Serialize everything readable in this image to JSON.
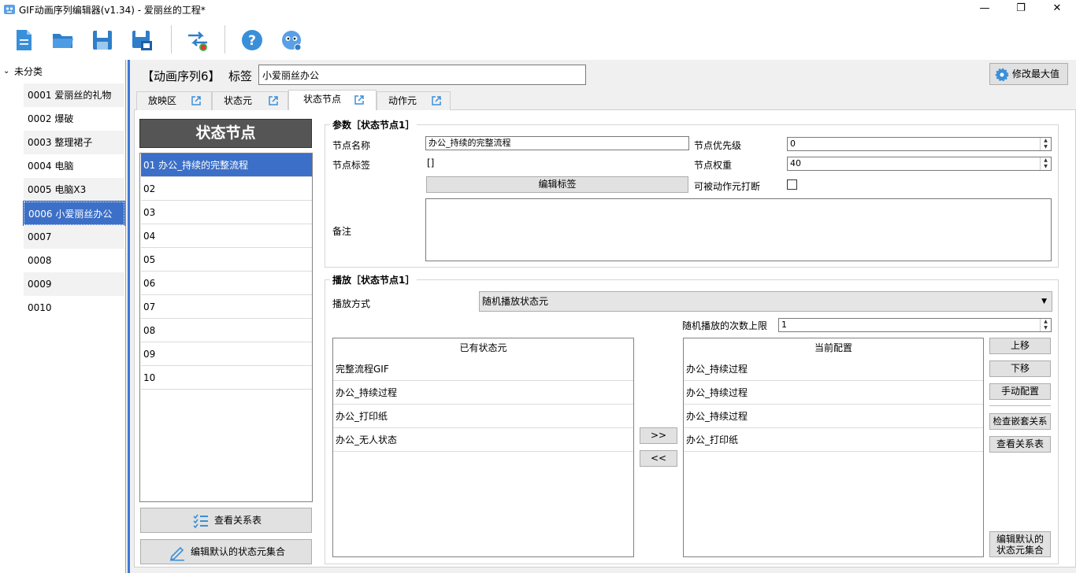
{
  "window": {
    "title": "GIF动画序列编辑器(v1.34) - 爱丽丝的工程*",
    "min_label": "—",
    "max_label": "❐",
    "close_label": "✕"
  },
  "toolbar": {
    "icons": [
      "new-file-icon",
      "open-folder-icon",
      "save-icon",
      "save-as-icon",
      "convert-icon",
      "help-icon",
      "about-icon"
    ]
  },
  "tree": {
    "root_label": "未分类",
    "items": [
      {
        "label": "0001 爱丽丝的礼物"
      },
      {
        "label": "0002 爆破"
      },
      {
        "label": "0003 整理裙子"
      },
      {
        "label": "0004 电脑"
      },
      {
        "label": "0005 电脑X3"
      },
      {
        "label": "0006 小爱丽丝办公"
      },
      {
        "label": "0007"
      },
      {
        "label": "0008"
      },
      {
        "label": "0009"
      },
      {
        "label": "0010"
      }
    ]
  },
  "header": {
    "sequence_label": "【动画序列6】",
    "tag_label": "标签",
    "tag_value": "小爱丽丝办公",
    "max_button": "修改最大值"
  },
  "tabs": [
    {
      "label": "放映区"
    },
    {
      "label": "状态元"
    },
    {
      "label": "状态节点"
    },
    {
      "label": "动作元"
    }
  ],
  "nodes": {
    "header": "状态节点",
    "items": [
      "01 办公_持续的完整流程",
      "02",
      "03",
      "04",
      "05",
      "06",
      "07",
      "08",
      "09",
      "10"
    ],
    "view_relations_button": "查看关系表",
    "edit_default_button": "编辑默认的状态元集合"
  },
  "params": {
    "title": "参数［状态节点1］",
    "name_label": "节点名称",
    "name_value": "办公_持续的完整流程",
    "priority_label": "节点优先级",
    "priority_value": "0",
    "tag_label": "节点标签",
    "tag_value": "[]",
    "weight_label": "节点权重",
    "weight_value": "40",
    "edit_tag_button": "编辑标签",
    "interrupt_label": "可被动作元打断",
    "note_label": "备注"
  },
  "playback": {
    "title": "播放［状态节点1］",
    "mode_label": "播放方式",
    "mode_value": "随机播放状态元",
    "limit_label": "随机播放的次数上限",
    "limit_value": "1",
    "available_header": "已有状态元",
    "available": [
      "完整流程GIF",
      "办公_持续过程",
      "办公_打印纸",
      "办公_无人状态"
    ],
    "current_header": "当前配置",
    "current": [
      "办公_持续过程",
      "办公_持续过程",
      "办公_持续过程",
      "办公_打印纸"
    ],
    "add_button": ">>",
    "remove_button": "<<",
    "up_button": "上移",
    "down_button": "下移",
    "manual_button": "手动配置",
    "check_nest_button": "检查嵌套关系",
    "view_rel_button": "查看关系表",
    "edit_default_line1": "编辑默认的",
    "edit_default_line2": "状态元集合"
  }
}
